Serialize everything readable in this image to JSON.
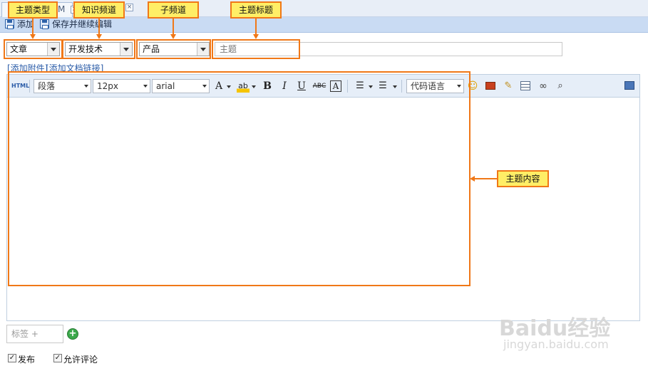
{
  "tabs": [
    {
      "label": "M"
    }
  ],
  "toolbar": {
    "add_label": "添加",
    "save_continue_label": "保存并继续编辑"
  },
  "form": {
    "type_value": "文章",
    "channel_value": "开发技术",
    "subchannel_value": "产品",
    "title_placeholder": "主题",
    "add_attachment": "[添加附件]",
    "add_doc_link": "[添加文档链接]"
  },
  "editor": {
    "html_label": "HTML",
    "paragraph": "段落",
    "font_size": "12px",
    "font_family": "arial",
    "code_language": "代码语言",
    "bold": "B",
    "italic": "I",
    "underline": "U",
    "strike": "ABC",
    "font_color": "A",
    "highlight": "ab"
  },
  "callouts": {
    "topic_type": "主题类型",
    "knowledge_channel": "知识频道",
    "sub_channel": "子频道",
    "topic_title": "主题标题",
    "topic_content": "主题内容"
  },
  "bottom": {
    "tag_placeholder": "标签 +",
    "publish_label": "发布",
    "allow_comment_label": "允许评论"
  },
  "watermark": {
    "brand": "Baidu经验",
    "url": "jingyan.baidu.com"
  },
  "colors": {
    "accent_orange": "#f07818",
    "callout_fill": "#ffee66",
    "toolbar_blue": "#c9dbf3"
  }
}
